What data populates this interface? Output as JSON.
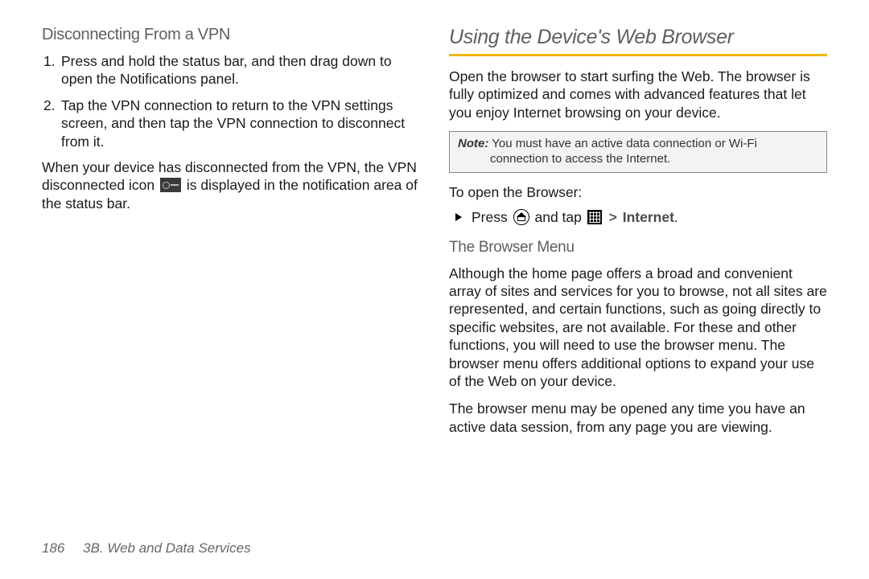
{
  "left": {
    "heading": "Disconnecting From a VPN",
    "step1_num": "1.",
    "step1": "Press and hold the status bar, and then drag down to open the Notifications panel.",
    "step2_num": "2.",
    "step2": "Tap the VPN connection to return to the VPN settings screen, and then tap the VPN connection to disconnect from it.",
    "para_before": "When your device has disconnected from the VPN, the VPN disconnected icon",
    "para_after": "is displayed in the notification area of the status bar."
  },
  "right": {
    "title": "Using the Device's Web Browser",
    "intro": "Open the browser to start surfing the Web. The browser is fully optimized and comes with advanced features that let you enjoy Internet browsing on your device.",
    "note_label": "Note:",
    "note_text": "You must have an active data connection or Wi-Fi connection to access the Internet.",
    "open_heading": "To open the Browser:",
    "press_text": "Press",
    "tap_text": "and tap",
    "gt": ">",
    "internet": "Internet",
    "period": ".",
    "menu_heading": "The Browser Menu",
    "menu_para1": "Although the home page offers a broad and convenient array of sites and services for you to browse, not all sites are represented, and certain functions, such as going directly to specific websites, are not available. For these and other functions, you will need to use the browser menu. The browser menu offers additional options to expand your use of the Web on your device.",
    "menu_para2": "The browser menu may be opened any time you have an active data session, from any page you are viewing."
  },
  "footer": {
    "page": "186",
    "section": "3B. Web and Data Services"
  }
}
